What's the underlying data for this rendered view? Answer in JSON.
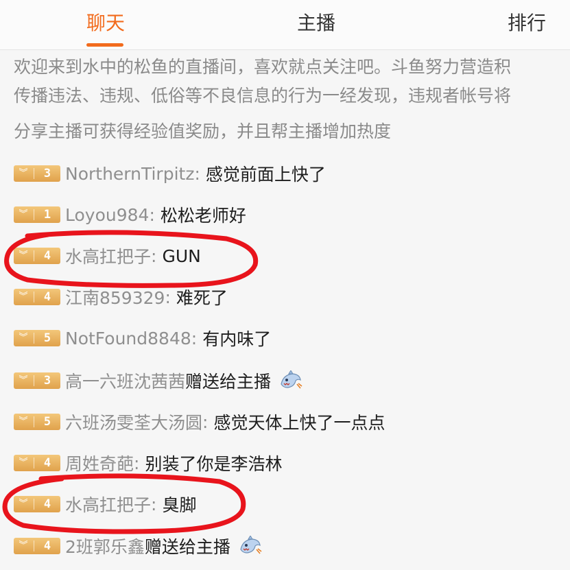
{
  "tabs": [
    {
      "label": "聊天",
      "active": true
    },
    {
      "label": "主播",
      "active": false
    },
    {
      "label": "排行",
      "active": false
    }
  ],
  "notices": [
    "欢迎来到水中的松鱼的直播间，喜欢就点关注吧。斗鱼努力营造积",
    "传播违法、违规、低俗等不良信息的行为一经发现，违规者帐号将",
    "分享主播可获得经验值奖励，并且帮主播增加热度"
  ],
  "messages": [
    {
      "level": "3",
      "user": "NorthernTirpitz",
      "colon": ":",
      "text": "感觉前面上快了"
    },
    {
      "level": "1",
      "user": "Loyou984",
      "colon": ":",
      "text": "松松老师好"
    },
    {
      "level": "4",
      "user": "水高扛把子",
      "colon": ":",
      "text": "GUN"
    },
    {
      "level": "4",
      "user": "江南859329",
      "colon": ":",
      "text": "难死了"
    },
    {
      "level": "5",
      "user": "NotFound8848",
      "colon": ":",
      "text": "有内味了"
    },
    {
      "level": "3",
      "user": "高一六班沈茜茜",
      "colon": "",
      "text": "赠送给主播",
      "gift": "shark-gift-icon"
    },
    {
      "level": "5",
      "user": "六班汤雯荃大汤圆",
      "colon": ":",
      "text": "感觉天体上快了一点点"
    },
    {
      "level": "4",
      "user": "周姓奇葩",
      "colon": ":",
      "text": "别装了你是李浩林"
    },
    {
      "level": "4",
      "user": "水高扛把子",
      "colon": ":",
      "text": "臭脚"
    },
    {
      "level": "4",
      "user": "2班郭乐鑫",
      "colon": "",
      "text": "赠送给主播",
      "gift": "shark-gift-icon"
    }
  ],
  "colors": {
    "accent": "#f26b1d",
    "badge": "#e8b060",
    "highlight_circle": "#e8141c"
  }
}
